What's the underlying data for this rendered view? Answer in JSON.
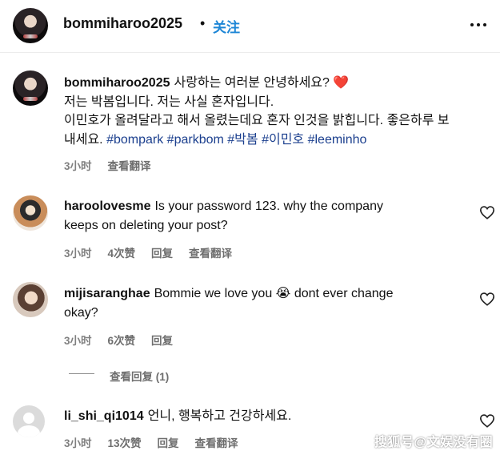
{
  "header": {
    "username": "bommiharoo2025",
    "separator": "•",
    "follow_label": "关注",
    "more_icon": "more-horizontal-icon"
  },
  "caption": {
    "username": "bommiharoo2025",
    "line1": "사랑하는 여러분 안녕하세요? ❤️",
    "line2": "저는 박봄입니다. 저는 사실 혼자입니다.",
    "line3": "이민호가 올려달라고 해서 올렸는데요 혼자 인것을 밝힙니다. 좋은하루 보",
    "line4_text": "내세요. ",
    "hashtags": [
      "#bompark",
      "#parkbom",
      "#박봄",
      "#이민호",
      "#leeminho"
    ],
    "time": "3小时",
    "translate_label": "查看翻译"
  },
  "comments": [
    {
      "username": "haroolovesme",
      "text_line1": "Is your password 123. why the company",
      "text_line2": "keeps on deleting your post?",
      "time": "3小时",
      "likes": "4次赞",
      "reply_label": "回复",
      "translate_label": "查看翻译"
    },
    {
      "username": "mijisaranghae",
      "text_line1": "Bommie we love you 😭 dont ever change",
      "text_line2": "okay?",
      "time": "3小时",
      "likes": "6次赞",
      "reply_label": "回复",
      "view_replies_label": "查看回复 (1)"
    },
    {
      "username": "li_shi_qi1014",
      "text_line1": "언니, 행복하고 건강하세요.",
      "time": "3小时",
      "likes": "13次赞",
      "reply_label": "回复",
      "translate_label": "查看翻译"
    }
  ],
  "watermark": "搜狐号@文娱没有圈",
  "colors": {
    "follow": "#1d86d6",
    "hashtag": "#1b3f8e",
    "meta": "#7a7a7a"
  },
  "icons": {
    "like": "heart-outline-icon"
  }
}
